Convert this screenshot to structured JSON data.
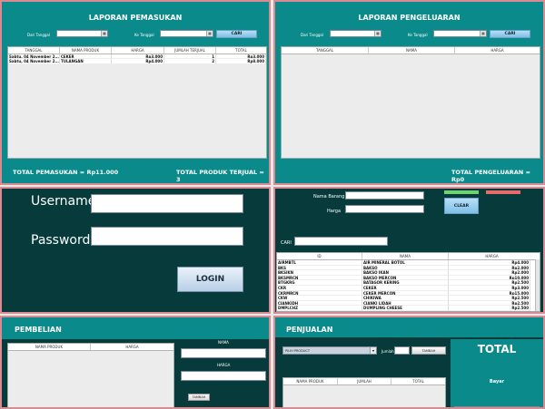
{
  "pemasukan": {
    "title": "LAPORAN PEMASUKAN",
    "dari_label": "Dari Tanggal",
    "ke_label": "Ke Tanggal",
    "cari_label": "CARI",
    "columns": [
      "TANGGAL",
      "NAMA PRODUK",
      "HARGA",
      "JUMLAH TERJUAL",
      "TOTAL"
    ],
    "rows": [
      [
        "Sabtu, 04 November 2...",
        "CEKER",
        "Rp3.000",
        "1",
        "Rp3.000"
      ],
      [
        "Sabtu, 04 November 2...",
        "TULANGAN",
        "Rp4.000",
        "2",
        "Rp8.000"
      ]
    ],
    "total_pemasukan": "TOTAL PEMASUKAN = Rp11.000",
    "total_produk": "TOTAL PRODUK TERJUAL = 3"
  },
  "pengeluaran": {
    "title": "LAPORAN PENGELUARAN",
    "dari_label": "Dari Tanggal",
    "ke_label": "Ke Tanggal",
    "cari_label": "CARI",
    "columns": [
      "TANGGAL",
      "NAMA",
      "HARGA"
    ],
    "total": "TOTAL PENGELUARAN = Rp0"
  },
  "login": {
    "username_label": "Username",
    "password_label": "Password",
    "button": "LOGIN"
  },
  "barang": {
    "nama_label": "Nama Barang",
    "harga_label": "Harga",
    "clear_label": "CLEAR",
    "cari_label": "CARI",
    "columns": [
      "ID",
      "NAMA",
      "HARGA"
    ],
    "rows": [
      [
        "AIRMBTL",
        "AIR MINERAL BOTOL",
        "Rp4.000"
      ],
      [
        "BKS",
        "BAKSO",
        "Rp2.000"
      ],
      [
        "BKSIKN",
        "BAKSO IKAN",
        "Rp2.000"
      ],
      [
        "BKSMRCN",
        "BAKSO MERCON",
        "Rp10.000"
      ],
      [
        "BTGKRG",
        "BATAGOR KERING",
        "Rp2.500"
      ],
      [
        "CKR",
        "CEKER",
        "Rp3.000"
      ],
      [
        "CKRMRCN",
        "CEKER MERCON",
        "Rp15.000"
      ],
      [
        "CKW",
        "CHIKIWA",
        "Rp2.500"
      ],
      [
        "CIANKIDH",
        "CIANKI LIDAH",
        "Rp2.500"
      ],
      [
        "DMPLCHZ",
        "DUMPLING CHEESE",
        "Rp2.500"
      ]
    ]
  },
  "pembelian": {
    "title": "PEMBELIAN",
    "columns": [
      "NAMA PRODUK",
      "HARGA"
    ],
    "nama_label": "NAMA",
    "harga_label": "HARGA",
    "tambah_label": "TAMBAH"
  },
  "penjualan": {
    "title": "PENJUALAN",
    "product_select": "PILIH PRODUCT",
    "jumlah_label": "Jumlah",
    "tambah_label": "TAMBAH",
    "columns": [
      "NAMA PRODUK",
      "JUMLAH",
      "TOTAL"
    ],
    "total_label": "TOTAL",
    "bayar_label": "Bayar"
  }
}
